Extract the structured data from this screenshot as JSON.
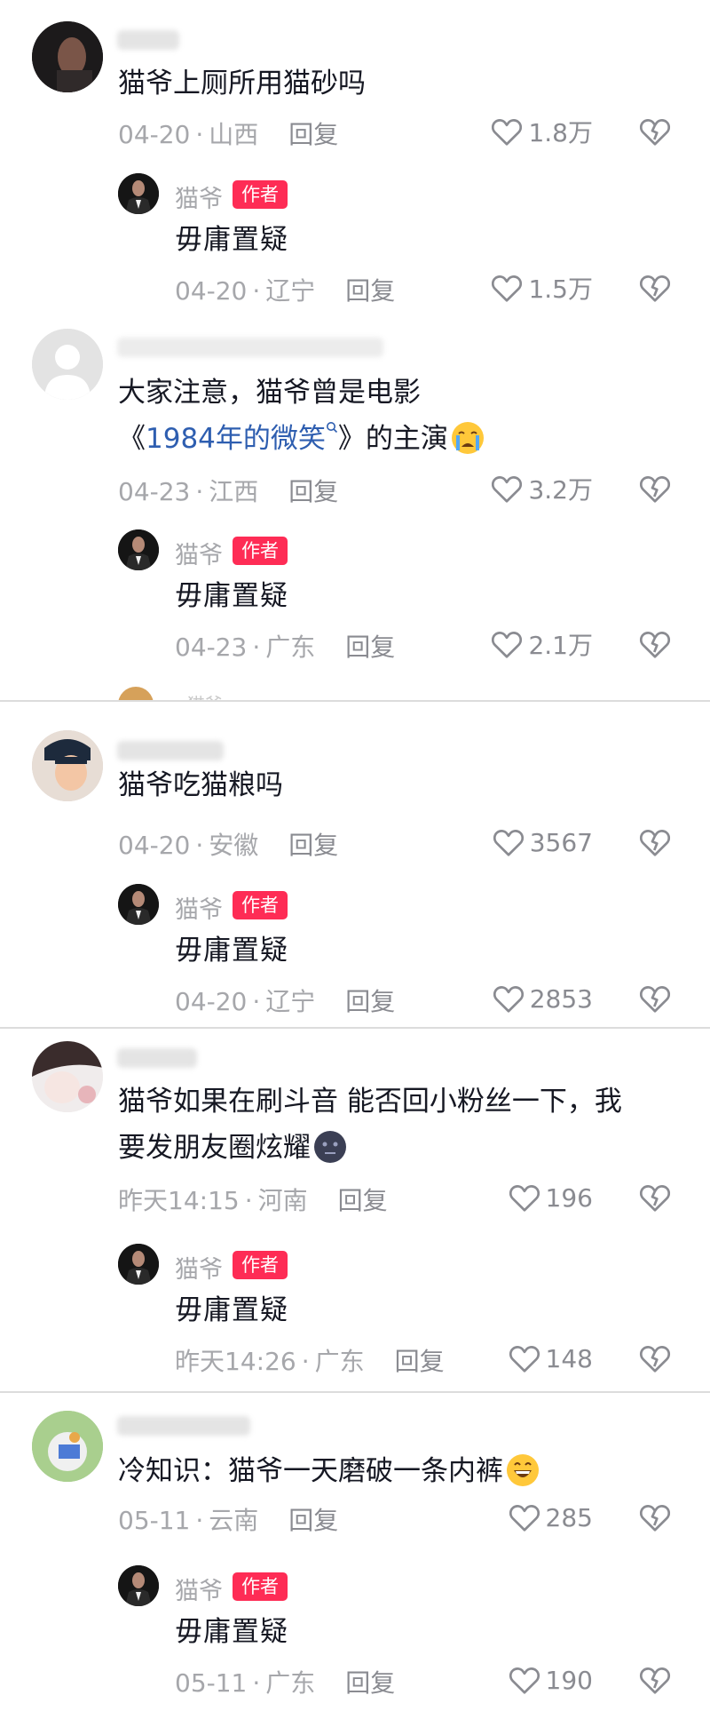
{
  "comments": [
    {
      "text_lines": [
        "猫爷上厕所用猫砂吗"
      ],
      "date": "04-20",
      "region": "山西",
      "reply_label": "回复",
      "likes": "1.8万",
      "reply": {
        "author": "猫爷",
        "badge": "作者",
        "text": "毋庸置疑",
        "date": "04-20",
        "region": "辽宁",
        "reply_label": "回复",
        "likes": "1.5万"
      }
    },
    {
      "text_lines": [
        "大家注意，猫爷曾是电影"
      ],
      "line2_prefix": "《",
      "line2_link": "1984年的微笑",
      "line2_suffix": "》的主演",
      "date": "04-23",
      "region": "江西",
      "reply_label": "回复",
      "likes": "3.2万",
      "reply": {
        "author": "猫爷",
        "badge": "作者",
        "text": "毋庸置疑",
        "date": "04-23",
        "region": "广东",
        "reply_label": "回复",
        "likes": "2.1万"
      }
    },
    {
      "text_lines": [
        "猫爷吃猫粮吗"
      ],
      "date": "04-20",
      "region": "安徽",
      "reply_label": "回复",
      "likes": "3567",
      "reply": {
        "author": "猫爷",
        "badge": "作者",
        "text": "毋庸置疑",
        "date": "04-20",
        "region": "辽宁",
        "reply_label": "回复",
        "likes": "2853"
      }
    },
    {
      "text_lines": [
        "猫爷如果在刷斗音 能否回小粉丝一下，我",
        "要发朋友圈炫耀"
      ],
      "date": "昨天14:15",
      "region": "河南",
      "reply_label": "回复",
      "likes": "196",
      "reply": {
        "author": "猫爷",
        "badge": "作者",
        "text": "毋庸置疑",
        "date": "昨天14:26",
        "region": "广东",
        "reply_label": "回复",
        "likes": "148"
      }
    },
    {
      "text_lines": [
        "冷知识：猫爷一天磨破一条内裤"
      ],
      "date": "05-11",
      "region": "云南",
      "reply_label": "回复",
      "likes": "285",
      "reply": {
        "author": "猫爷",
        "badge": "作者",
        "text": "毋庸置疑",
        "date": "05-11",
        "region": "广东",
        "reply_label": "回复",
        "likes": "190"
      }
    }
  ],
  "separator": "·",
  "peek_text": "· 猫爷",
  "colors": {
    "badge": "#fe2c55",
    "link": "#2e5eb0",
    "meta": "#a6a7ab",
    "text": "#161823"
  }
}
